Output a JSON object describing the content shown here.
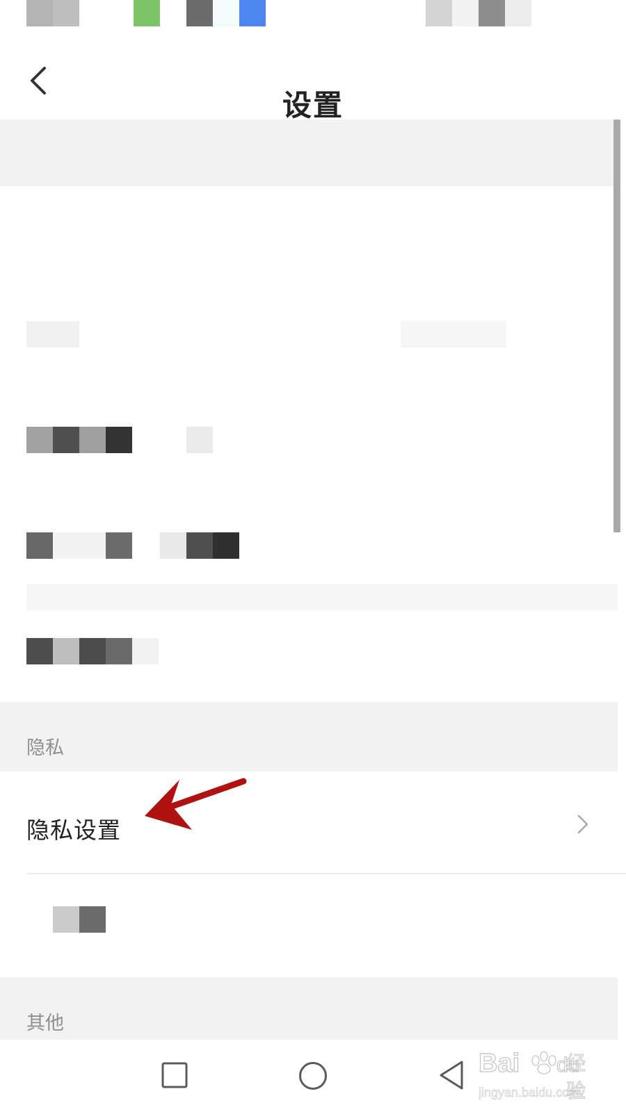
{
  "header": {
    "title": "设置",
    "back_icon": "chevron-left-icon"
  },
  "sections": [
    {
      "label": "隐私",
      "items": [
        {
          "label": "隐私设置",
          "icon": "chevron-right-icon"
        }
      ]
    },
    {
      "label": "其他"
    }
  ],
  "nav_bar": {
    "icons": [
      "square-icon",
      "circle-icon",
      "triangle-back-icon"
    ]
  },
  "annotation": {
    "color": "#b01212",
    "icon": "red-arrow"
  },
  "colors": {
    "background": "#ffffff",
    "section_background": "#f2f2f2",
    "section_text": "#8f8f8f",
    "primary_text": "#222222"
  },
  "watermark": {
    "brand_latin": "Bai",
    "brand_du": "du",
    "brand_cn": "经验",
    "url": "jingyan.baidu.com"
  }
}
